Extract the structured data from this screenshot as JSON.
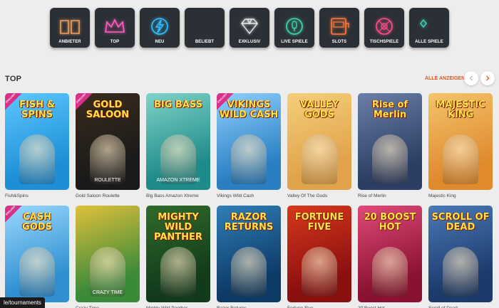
{
  "categories": [
    {
      "label": "ANBIETER",
      "icon": "book-icon",
      "color": "#f2a05c"
    },
    {
      "label": "TOP",
      "icon": "crown-icon",
      "color": "#ff5fc0"
    },
    {
      "label": "NEU",
      "icon": "lightning-icon",
      "color": "#2ec4ff"
    },
    {
      "label": "BELIEBT",
      "icon": "flame-icon",
      "color": "#ff5a3c"
    },
    {
      "label": "EXKLUSIV",
      "icon": "diamond-icon",
      "color": "#e8e8e8"
    },
    {
      "label": "LIVE SPIELE",
      "icon": "microphone-icon",
      "color": "#3fd9b0"
    },
    {
      "label": "SLOTS",
      "icon": "slot-machine-icon",
      "color": "#ff7a3c"
    },
    {
      "label": "TISCHSPIELE",
      "icon": "roulette-icon",
      "color": "#ff4f8a"
    },
    {
      "label": "ALLE SPIELE",
      "icon": "card-suits-icon",
      "color": "#3fe0c0"
    }
  ],
  "section": {
    "title": "TOP",
    "show_all": "ALLE ANZEIGEN"
  },
  "games_row1": [
    {
      "name": "Fish&Spins",
      "art": "FISH & SPINS",
      "sub": "",
      "bg": "#1e8fd6",
      "bg2": "#5cc8ff",
      "exclusive": true,
      "exclusive_label": "EXKLUSIV"
    },
    {
      "name": "Gold Saloon Roulette",
      "art": "GOLD SALOON",
      "sub": "ROULETTE",
      "bg": "#1a1a1a",
      "bg2": "#3a2b1c",
      "exclusive": true,
      "exclusive_label": "EXKLUSIV"
    },
    {
      "name": "Big Bass Amazon Xtreme",
      "art": "BIG BASS",
      "sub": "AMAZON XTREME",
      "bg": "#1f8a8a",
      "bg2": "#7fd3c7",
      "exclusive": false
    },
    {
      "name": "Vikings Wild Cash",
      "art": "VIKINGS WILD CASH",
      "sub": "",
      "bg": "#2a7fc2",
      "bg2": "#8fd0ff",
      "exclusive": true,
      "exclusive_label": "EXKLUSIV"
    },
    {
      "name": "Valley Of The Gods",
      "art": "VALLEY GODS",
      "sub": "",
      "bg": "#e0a24a",
      "bg2": "#f5cf7a",
      "exclusive": false
    },
    {
      "name": "Rise of Merlin",
      "art": "Rise of Merlin",
      "sub": "",
      "bg": "#2c3e63",
      "bg2": "#6a7fa8",
      "exclusive": false
    },
    {
      "name": "Majestic King",
      "art": "MAJESTIC KING",
      "sub": "",
      "bg": "#e08a2e",
      "bg2": "#f4c46a",
      "exclusive": false
    }
  ],
  "games_row2": [
    {
      "name": "Cash of Gods",
      "art": "CASH GODS",
      "sub": "",
      "bg": "#2f8fd0",
      "bg2": "#9ad8ff",
      "exclusive": true,
      "exclusive_label": "EXKLUSIV"
    },
    {
      "name": "Crazy Time",
      "art": "",
      "sub": "CRAZY TIME",
      "bg": "#3a8a3a",
      "bg2": "#e0c03a",
      "exclusive": false
    },
    {
      "name": "Mighty Wild Panther",
      "art": "MIGHTY WILD PANTHER",
      "sub": "",
      "bg": "#123b1c",
      "bg2": "#2f6b2a",
      "exclusive": false
    },
    {
      "name": "Razor Returns",
      "art": "RAZOR RETURNS",
      "sub": "",
      "bg": "#0e3a66",
      "bg2": "#2e7fb8",
      "exclusive": false
    },
    {
      "name": "Fortune Five",
      "art": "FORTUNE FIVE",
      "sub": "",
      "bg": "#8a0f0f",
      "bg2": "#d8381c",
      "exclusive": false
    },
    {
      "name": "20 Boost Hot",
      "art": "20 BOOST HOT",
      "sub": "",
      "bg": "#8a1230",
      "bg2": "#e04a7a",
      "exclusive": false
    },
    {
      "name": "Scroll of Dead",
      "art": "SCROLL OF DEAD",
      "sub": "",
      "bg": "#1c3a6a",
      "bg2": "#4a7ab8",
      "exclusive": false
    }
  ],
  "status_url": "le/tournaments"
}
